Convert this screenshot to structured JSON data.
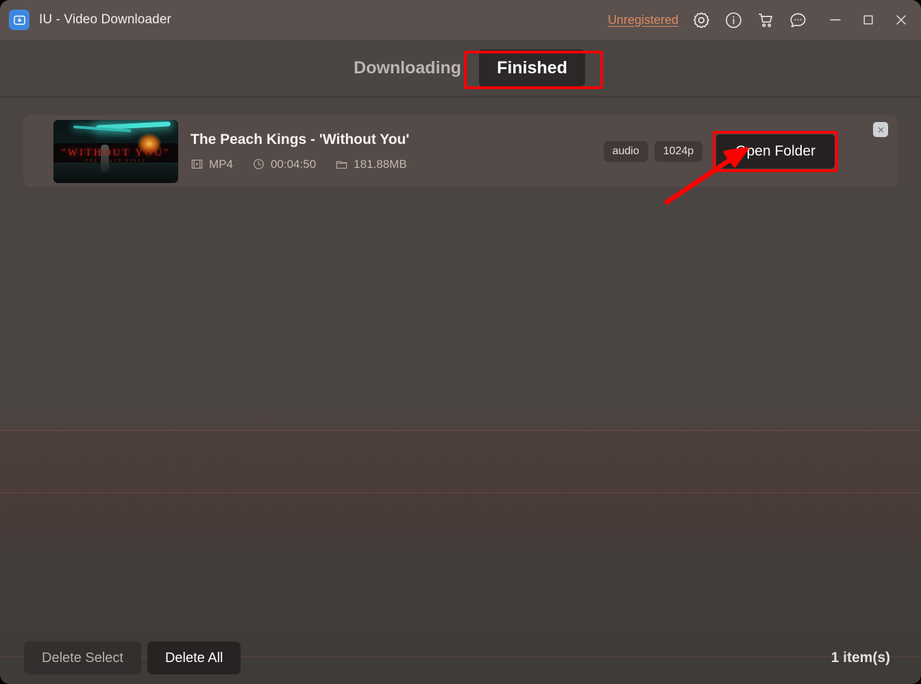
{
  "window": {
    "title": "IU - Video Downloader",
    "app_icon": "download-box-icon",
    "accent_color": "#3d87e0",
    "highlight_color": "#fe0000"
  },
  "titlebar": {
    "unregistered_label": "Unregistered",
    "icons": [
      {
        "name": "gear-icon",
        "label": "Settings"
      },
      {
        "name": "info-icon",
        "label": "Info"
      },
      {
        "name": "cart-icon",
        "label": "Buy"
      },
      {
        "name": "feedback-icon",
        "label": "Feedback"
      }
    ],
    "window_controls": [
      {
        "name": "minimize-icon",
        "label": "Minimize"
      },
      {
        "name": "maximize-icon",
        "label": "Maximize"
      },
      {
        "name": "close-icon",
        "label": "Close"
      }
    ]
  },
  "tabs": [
    {
      "label": "Downloading",
      "active": false
    },
    {
      "label": "Finished",
      "active": true
    }
  ],
  "item": {
    "title": "The Peach Kings - 'Without You'",
    "thumbnail_title": "\"WITHOUT YOU\"",
    "thumbnail_subtitle": "THE PEACH KINGS",
    "format": "MP4",
    "duration": "00:04:50",
    "size": "181.88MB",
    "badges": [
      "audio",
      "1024p"
    ],
    "open_folder_label": "Open Folder",
    "close_icon": "close-icon",
    "format_icon": "film-icon",
    "duration_icon": "clock-icon",
    "size_icon": "folder-icon"
  },
  "bottom": {
    "delete_select_label": "Delete Select",
    "delete_all_label": "Delete All",
    "item_count": "1 item(s)"
  }
}
